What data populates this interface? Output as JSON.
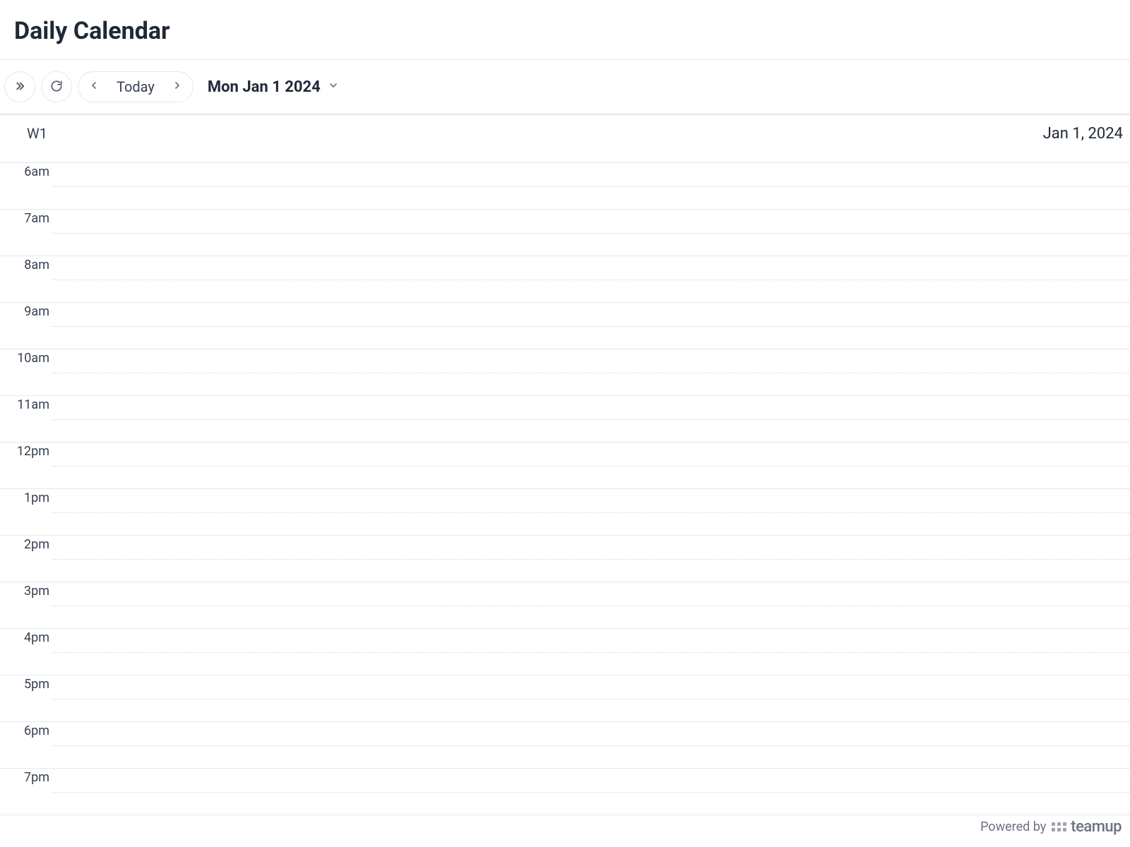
{
  "header": {
    "title": "Daily Calendar"
  },
  "toolbar": {
    "today_label": "Today",
    "date_display": "Mon Jan 1 2024"
  },
  "day_header": {
    "week_label": "W1",
    "date": "Jan 1, 2024"
  },
  "time_slots": [
    "6am",
    "7am",
    "8am",
    "9am",
    "10am",
    "11am",
    "12pm",
    "1pm",
    "2pm",
    "3pm",
    "4pm",
    "5pm",
    "6pm",
    "7pm"
  ],
  "footer": {
    "powered_by": "Powered by",
    "brand": "teamup"
  }
}
